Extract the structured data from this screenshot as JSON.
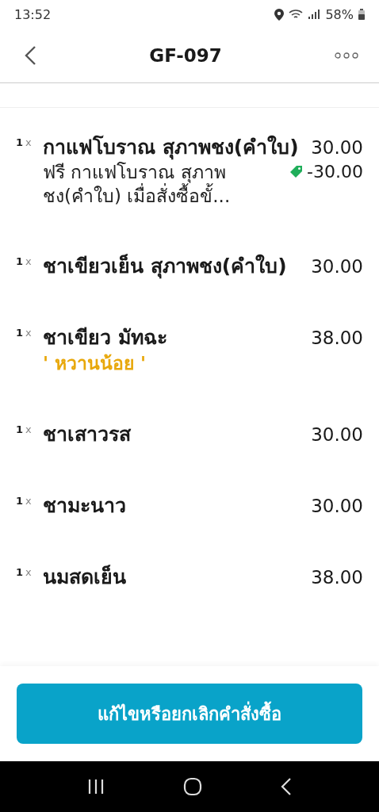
{
  "status_bar": {
    "time": "13:52",
    "battery": "58%"
  },
  "header": {
    "title": "GF-097"
  },
  "items": [
    {
      "qty": "1",
      "times": "x",
      "name": "กาแฟโบราณ สุภาพชง(คำใบ)",
      "price": "30.00",
      "notes": [
        {
          "kind": "discount",
          "text": "ฟรี กาแฟโบราณ สุภาพชง(คำใบ) เมื่อสั่งซื้อขั้...",
          "amount": "-30.00"
        }
      ]
    },
    {
      "qty": "1",
      "times": "x",
      "name": "ชาเขียวเย็น สุภาพชง(คำใบ)",
      "price": "30.00"
    },
    {
      "qty": "1",
      "times": "x",
      "name": "ชาเขียว มัทฉะ",
      "price": "38.00",
      "notes": [
        {
          "kind": "option",
          "text": "' หวานน้อย '"
        }
      ]
    },
    {
      "qty": "1",
      "times": "x",
      "name": "ชาเสาวรส",
      "price": "30.00"
    },
    {
      "qty": "1",
      "times": "x",
      "name": "ชามะนาว",
      "price": "30.00"
    },
    {
      "qty": "1",
      "times": "x",
      "name": "นมสดเย็น",
      "price": "38.00"
    }
  ],
  "action_button": "แก้ไขหรือยกเลิกคำสั่งซื้อ"
}
